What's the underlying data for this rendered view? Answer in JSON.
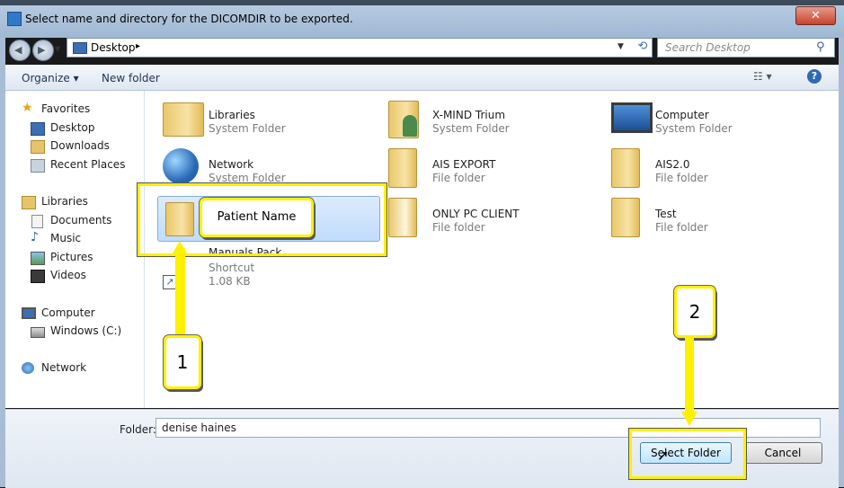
{
  "window": {
    "title": "Select name and directory for the DICOMDIR to be exported.",
    "close_label": "✕"
  },
  "nav": {
    "back_icon": "back-arrow-icon",
    "forward_icon": "forward-arrow-icon"
  },
  "address": {
    "location": "Desktop",
    "chevron": "▸"
  },
  "search": {
    "placeholder": "Search Desktop"
  },
  "toolbar": {
    "organize": "Organize ▾",
    "new_folder": "New folder",
    "help": "?"
  },
  "sidebar": {
    "items": [
      {
        "label": "Favorites",
        "icon": "star-icon"
      },
      {
        "label": "Desktop",
        "icon": "desktop-icon"
      },
      {
        "label": "Downloads",
        "icon": "downloads-icon"
      },
      {
        "label": "Recent Places",
        "icon": "recent-places-icon"
      },
      {
        "label": "Libraries",
        "icon": "libraries-icon"
      },
      {
        "label": "Documents",
        "icon": "documents-icon"
      },
      {
        "label": "Music",
        "icon": "music-icon"
      },
      {
        "label": "Pictures",
        "icon": "pictures-icon"
      },
      {
        "label": "Videos",
        "icon": "videos-icon"
      },
      {
        "label": "Computer",
        "icon": "computer-icon"
      },
      {
        "label": "Windows (C:)",
        "icon": "drive-icon"
      },
      {
        "label": "Network",
        "icon": "network-icon"
      }
    ]
  },
  "files": [
    {
      "name": "Libraries",
      "type": "System Folder"
    },
    {
      "name": "X-MIND Trium",
      "type": "System Folder"
    },
    {
      "name": "Computer",
      "type": "System Folder"
    },
    {
      "name": "Network",
      "type": "System Folder"
    },
    {
      "name": "AIS EXPORT",
      "type": "File folder"
    },
    {
      "name": "AIS2.0",
      "type": "File folder"
    },
    {
      "name": "ONLY PC CLIENT",
      "type": "File folder"
    },
    {
      "name": "Test",
      "type": "File folder"
    },
    {
      "name": "Manuals Pack",
      "type": "Shortcut",
      "size": "1.08 KB"
    }
  ],
  "footer": {
    "folder_label": "Folder:",
    "folder_value": "denise haines",
    "select_button": "Select Folder",
    "cancel_button": "Cancel"
  },
  "annotations": {
    "patient_name": "Patient Name",
    "step1": "1",
    "step2": "2",
    "highlight_color": "#fff000"
  }
}
